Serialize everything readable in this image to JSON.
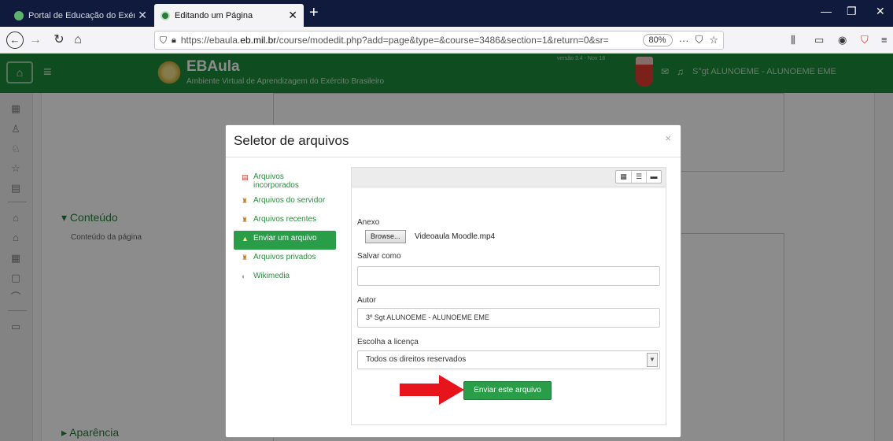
{
  "browser": {
    "tabs": [
      {
        "title": "Portal de Educação do Exército",
        "active": false
      },
      {
        "title": "Editando um Página",
        "active": true
      }
    ],
    "new_tab": "+",
    "url_prefix": "https://ebaula.",
    "url_domain": "eb.mil.br",
    "url_path": "/course/modedit.php?add=page&type=&course=3486&section=1&return=0&sr=",
    "zoom": "80%"
  },
  "site": {
    "brand": "EBAula",
    "subtitle": "Ambiente Virtual de Aprendizagem do Exército Brasileiro",
    "version": "versão 3.4 - Nov 18",
    "user": "S°gt ALUNOEME - ALUNOEME EME"
  },
  "page": {
    "section_content": "Conteúdo",
    "content_label": "Conteúdo da página",
    "section_appearance": "Aparência"
  },
  "modal": {
    "title": "Seletor de arquivos",
    "close": "×",
    "repositories": [
      {
        "label": "Arquivos incorporados",
        "icon": "file-icon",
        "active": false
      },
      {
        "label": "Arquivos do servidor",
        "icon": "server-icon",
        "active": false
      },
      {
        "label": "Arquivos recentes",
        "icon": "recent-icon",
        "active": false
      },
      {
        "label": "Enviar um arquivo",
        "icon": "upload-icon",
        "active": true
      },
      {
        "label": "Arquivos privados",
        "icon": "private-icon",
        "active": false
      },
      {
        "label": "Wikimedia",
        "icon": "wikimedia-icon",
        "active": false
      }
    ],
    "form": {
      "attachment_label": "Anexo",
      "browse_label": "Browse...",
      "selected_file": "Videoaula Moodle.mp4",
      "save_as_label": "Salvar como",
      "save_as_value": "",
      "author_label": "Autor",
      "author_value": "3º Sgt ALUNOEME  - ALUNOEME EME",
      "license_label": "Escolha a licença",
      "license_value": "Todos os direitos reservados",
      "submit_label": "Enviar este arquivo"
    }
  },
  "colors": {
    "brand_green": "#1d8b3a",
    "button_green": "#2a9d49",
    "arrow_red": "#e8141c"
  }
}
